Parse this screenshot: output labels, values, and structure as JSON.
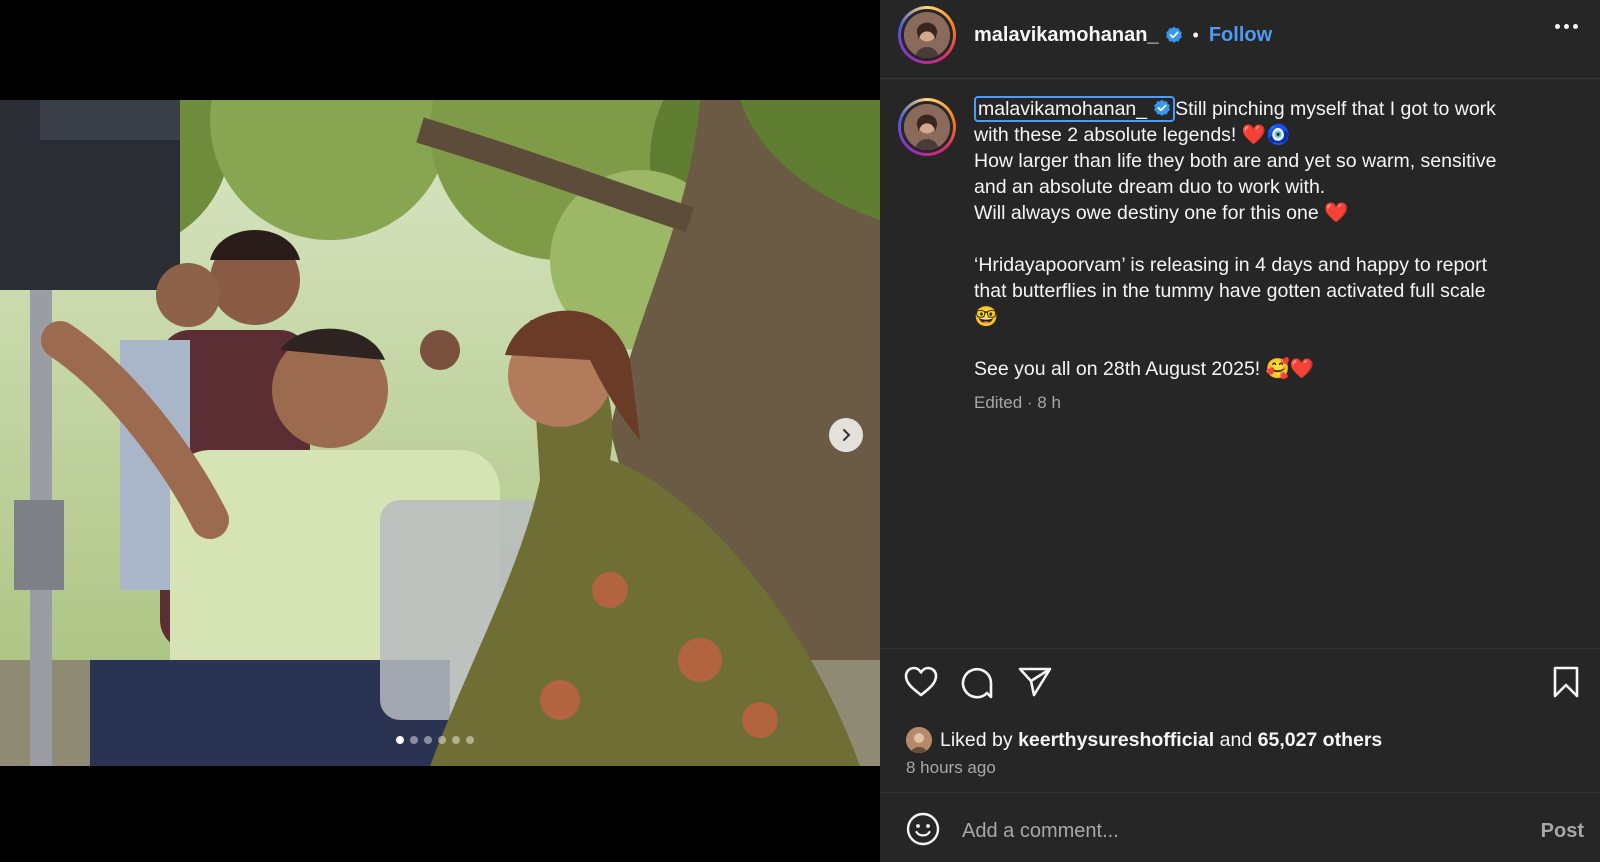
{
  "post": {
    "username": "malavikamohanan_",
    "separator": "•",
    "follow_label": "Follow",
    "caption_lines": [
      "Still pinching myself that I got to work",
      "with these 2 absolute legends! ❤️🧿",
      "How larger than life they both are and yet so warm, sensitive",
      "and an absolute dream duo to work with.",
      "Will always owe destiny one for this one ❤️",
      "",
      "‘Hridayapoorvam’ is releasing in 4 days and happy to report",
      "that butterflies in the tummy have gotten activated full scale",
      "🤓",
      "",
      "See you all on 28th August 2025! 🥰❤️"
    ],
    "edited_label": "Edited · 8 h",
    "liked_by_prefix": "Liked by",
    "liked_by_user": "keerthysureshofficial",
    "liked_by_and": "and",
    "liked_by_count": "65,027 others",
    "time_ago": "8 hours ago"
  },
  "carousel": {
    "slide_count": 6,
    "active_index": 0
  },
  "comment": {
    "placeholder": "Add a comment...",
    "post_label": "Post"
  },
  "icons": [
    "verified-badge-icon",
    "more-options-icon",
    "chevron-right-icon",
    "heart-icon",
    "comment-icon",
    "share-icon",
    "bookmark-icon",
    "emoji-icon"
  ],
  "colors": {
    "panel_bg": "#262626",
    "accent_blue": "#4c9bf5",
    "muted_text": "#a8a8a8",
    "media_bg": "#000000"
  }
}
